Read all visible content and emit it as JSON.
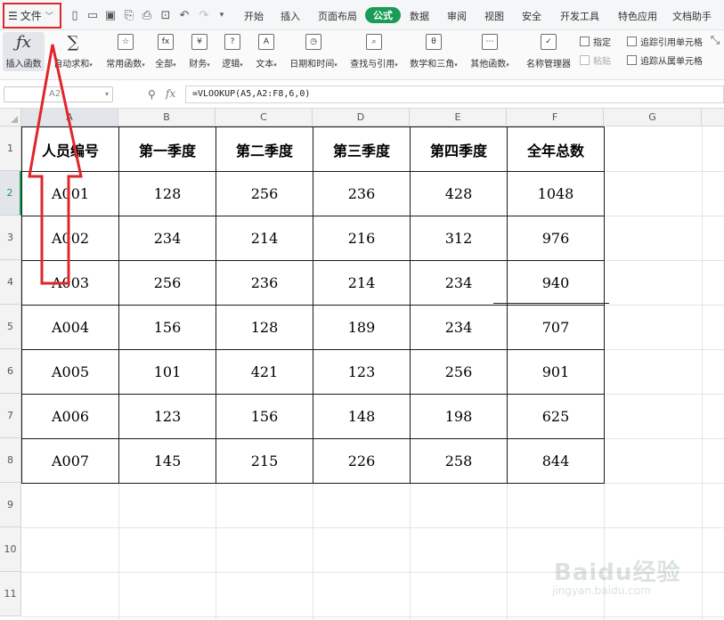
{
  "menubar": {
    "file_label": "文件",
    "tabs": [
      "开始",
      "插入",
      "页面布局",
      "公式",
      "数据",
      "审阅",
      "视图",
      "安全",
      "开发工具",
      "特色应用",
      "文档助手"
    ],
    "active_tab": "公式",
    "accent_color": "#1a9b57"
  },
  "ribbon": {
    "buttons": [
      {
        "label": "插入函数",
        "icon": "fx-icon",
        "glyph": "fx"
      },
      {
        "label": "自动求和",
        "icon": "sum-icon",
        "glyph": "∑"
      },
      {
        "label": "常用函数",
        "icon": "common-function-icon",
        "glyph": "☆"
      },
      {
        "label": "全部",
        "icon": "all-functions-icon",
        "glyph": "fx"
      },
      {
        "label": "财务",
        "icon": "finance-icon",
        "glyph": "¥"
      },
      {
        "label": "逻辑",
        "icon": "logic-icon",
        "glyph": "?"
      },
      {
        "label": "文本",
        "icon": "text-icon",
        "glyph": "A"
      },
      {
        "label": "日期和时间",
        "icon": "clock-icon",
        "glyph": "◷"
      },
      {
        "label": "查找与引用",
        "icon": "lookup-icon",
        "glyph": "⌕"
      },
      {
        "label": "数学和三角",
        "icon": "math-icon",
        "glyph": "θ"
      },
      {
        "label": "其他函数",
        "icon": "other-functions-icon",
        "glyph": "⋯"
      },
      {
        "label": "名称管理器",
        "icon": "name-manager-icon",
        "glyph": "✓"
      }
    ],
    "small": {
      "assign": "指定",
      "paste": "粘贴",
      "trace_precedents": "追踪引用单元格",
      "trace_dependents": "追踪从属单元格"
    }
  },
  "formulabar": {
    "namebox": "A2",
    "formula": "=VLOOKUP(A5,A2:F8,6,0)"
  },
  "grid": {
    "columns": [
      "A",
      "B",
      "C",
      "D",
      "E",
      "F",
      "G"
    ],
    "rows": [
      "1",
      "2",
      "3",
      "4",
      "5",
      "6",
      "7",
      "8",
      "9",
      "10",
      "11"
    ],
    "selected_row": "2"
  },
  "table": {
    "headers": [
      "人员编号",
      "第一季度",
      "第二季度",
      "第三季度",
      "第四季度",
      "全年总数"
    ],
    "rows": [
      [
        "A001",
        "128",
        "256",
        "236",
        "428",
        "1048"
      ],
      [
        "A002",
        "234",
        "214",
        "216",
        "312",
        "976"
      ],
      [
        "A003",
        "256",
        "236",
        "214",
        "234",
        "940"
      ],
      [
        "A004",
        "156",
        "128",
        "189",
        "234",
        "707"
      ],
      [
        "A005",
        "101",
        "421",
        "123",
        "256",
        "901"
      ],
      [
        "A006",
        "123",
        "156",
        "148",
        "198",
        "625"
      ],
      [
        "A007",
        "145",
        "215",
        "226",
        "258",
        "844"
      ]
    ]
  },
  "annotation": {
    "color": "#e0262a"
  },
  "watermark": {
    "logo": "Baidu经验",
    "url": "jingyan.baidu.com"
  }
}
